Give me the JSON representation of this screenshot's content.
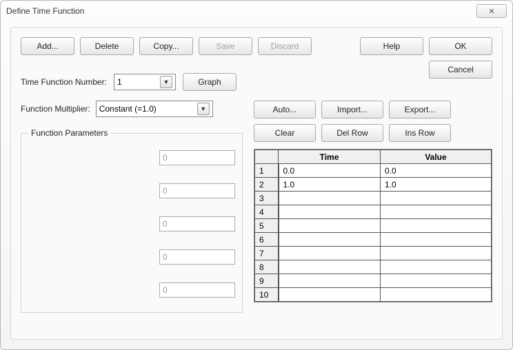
{
  "window": {
    "title": "Define Time Function"
  },
  "toolbar": {
    "add": "Add...",
    "delete": "Delete",
    "copy": "Copy...",
    "save": "Save",
    "discard": "Discard"
  },
  "side": {
    "help": "Help",
    "ok": "OK",
    "cancel": "Cancel"
  },
  "tfn": {
    "label": "Time Function Number:",
    "value": "1",
    "graph": "Graph"
  },
  "mult": {
    "label": "Function Multiplier:",
    "value": "Constant (=1.0)"
  },
  "params": {
    "legend": "Function Parameters",
    "p1": "0",
    "p2": "0",
    "p3": "0",
    "p4": "0",
    "p5": "0"
  },
  "tablebtns": {
    "auto": "Auto...",
    "import": "Import...",
    "export": "Export...",
    "clear": "Clear",
    "delrow": "Del Row",
    "insrow": "Ins Row"
  },
  "table": {
    "headers": {
      "time": "Time",
      "value": "Value"
    },
    "rows": [
      {
        "n": "1",
        "time": "0.0",
        "value": "0.0"
      },
      {
        "n": "2",
        "time": "1.0",
        "value": "1.0"
      },
      {
        "n": "3",
        "time": "",
        "value": ""
      },
      {
        "n": "4",
        "time": "",
        "value": ""
      },
      {
        "n": "5",
        "time": "",
        "value": ""
      },
      {
        "n": "6",
        "time": "",
        "value": ""
      },
      {
        "n": "7",
        "time": "",
        "value": ""
      },
      {
        "n": "8",
        "time": "",
        "value": ""
      },
      {
        "n": "9",
        "time": "",
        "value": ""
      },
      {
        "n": "10",
        "time": "",
        "value": ""
      }
    ]
  }
}
